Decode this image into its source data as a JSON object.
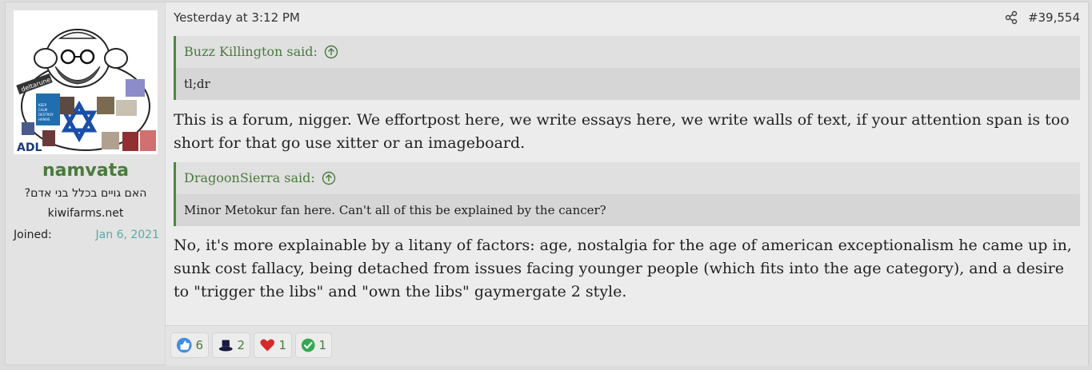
{
  "user": {
    "username": "namvata",
    "title": "האם גויים בכלל בני אדם?",
    "site": "kiwifarms.net",
    "joined_label": "Joined:",
    "joined_date": "Jan 6, 2021",
    "avatar_text": {
      "deltarune": "deltarune",
      "keep_calm": "KEEP CALM AND DESTROY HAMAS",
      "adl": "ADL"
    }
  },
  "post": {
    "date": "Yesterday at 3:12 PM",
    "number": "#39,554",
    "quote1": {
      "author": "Buzz Killington said:",
      "text": "tl;dr"
    },
    "text1": "This is a forum, nigger. We effortpost here, we write essays here, we write walls of text, if your attention span is too short for that go use xitter or an imageboard.",
    "quote2": {
      "author": "DragoonSierra said:",
      "text": "Minor Metokur fan here. Can't all of this be explained by the cancer?"
    },
    "text2": "No, it's more explainable by a litany of factors: age, nostalgia for the age of american exceptionalism he came up in, sunk cost fallacy, being detached from issues facing younger people (which fits into the age category), and a desire to \"trigger the libs\" and \"own the libs\" gaymergate 2 style."
  },
  "reactions": [
    {
      "icon": "thumbs-up-icon",
      "count": "6"
    },
    {
      "icon": "top-hat-icon",
      "count": "2"
    },
    {
      "icon": "heart-icon",
      "count": "1"
    },
    {
      "icon": "checkmark-icon",
      "count": "1"
    }
  ],
  "colors": {
    "accent_green": "#4a7a3c",
    "joined_date": "#5aa9a6"
  }
}
